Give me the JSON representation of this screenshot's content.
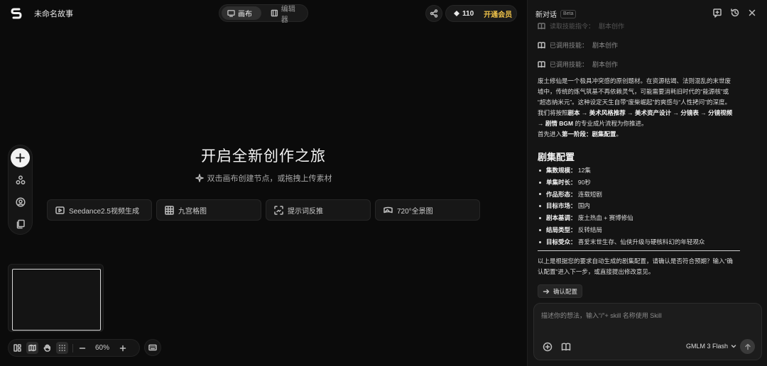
{
  "project": {
    "title": "未命名故事"
  },
  "view_toggle": {
    "canvas_label": "画布",
    "editor_label": "编辑器"
  },
  "credits": {
    "value": "110",
    "vip_label": "开通会员"
  },
  "hero": {
    "title": "开启全新创作之旅",
    "subtitle": "双击画布创建节点，或拖拽上传素材"
  },
  "quick_actions": [
    {
      "label": "Seedance2.5视频生成",
      "icon": "video-icon"
    },
    {
      "label": "九宫格图",
      "icon": "grid-icon"
    },
    {
      "label": "提示词反推",
      "icon": "scan-icon"
    },
    {
      "label": "720°全景图",
      "icon": "panorama-icon"
    }
  ],
  "zoom": {
    "value": "60%"
  },
  "chat": {
    "title": "新对话",
    "badge": "Beta",
    "skill_rows": [
      {
        "label": "读取技能指令：",
        "value": "剧本创作"
      },
      {
        "label": "已调用技能：",
        "value": "剧本创作"
      },
      {
        "label": "已调用技能：",
        "value": "剧本创作"
      }
    ],
    "intro": [
      "废土修仙是一个极具冲突感的原创题材。在资源枯竭、法则混乱的末世废",
      "墟中，传统的炼气筑基不再依赖灵气，可能需要消耗旧时代的“能源核”或",
      "“超态纳米元”。这种设定天生自带“废柴崛起”的爽感与“人性拷问”的深度。"
    ],
    "flow": {
      "lead": "我们将按照",
      "s1": "剧本",
      "s2": "美术风格推荐",
      "s3": "美术资产设计",
      "s4": "分镜表",
      "s5": "分镜视频",
      "s6": "剧情 BGM",
      "tail": "的专业成片流程为你推进。",
      "arrow": "→"
    },
    "stage": {
      "lead": "首先进入",
      "name": "第一阶段：剧集配置",
      "end": "。"
    },
    "section_title": "剧集配置",
    "config": [
      {
        "key": "集数规模：",
        "value": "12集"
      },
      {
        "key": "单集时长：",
        "value": "90秒"
      },
      {
        "key": "作品形态：",
        "value": "连载短剧"
      },
      {
        "key": "目标市场：",
        "value": "国内"
      },
      {
        "key": "剧本基调：",
        "value": "废土热血 + 赛博修仙"
      },
      {
        "key": "结局类型：",
        "value": "反转结局"
      },
      {
        "key": "目标受众：",
        "value": "喜爱末世生存、仙侠升级与硬核科幻的年轻观众"
      }
    ],
    "followup_1": "以上是根据您的要求自动生成的剧集配置，请确认是否符合预期？输入“确",
    "followup_2": "认配置”进入下一步，或直接提出修改意见。",
    "confirm_label": "确认配置",
    "input_placeholder": "描述你的想法，输入“/”+ skill 名称使用 Skill",
    "model": "GMLM 3 Flash"
  },
  "colors": {
    "accent_gold": "#f0c34a",
    "bg": "#0b0b0b",
    "panel": "#141414"
  }
}
